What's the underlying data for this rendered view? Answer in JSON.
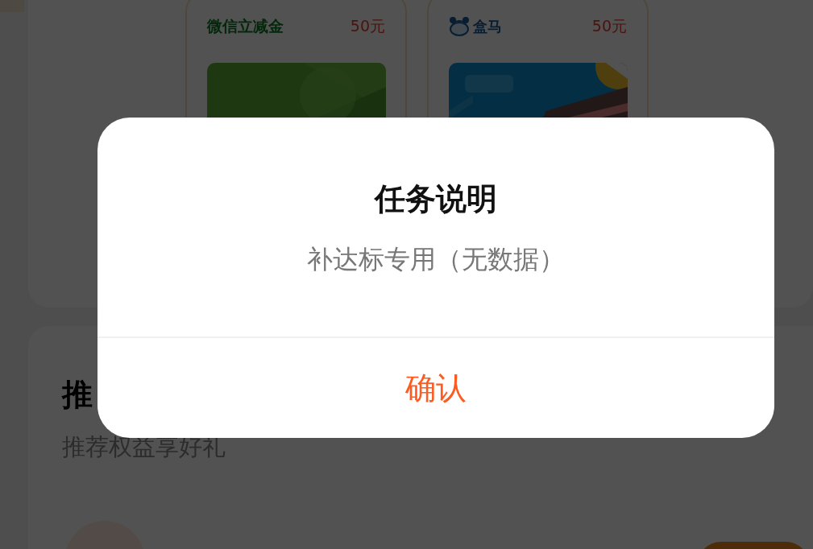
{
  "coupons": [
    {
      "brand": {
        "kind": "text",
        "name": "微信立减金"
      },
      "amount": "50元"
    },
    {
      "brand": {
        "kind": "logo",
        "name": "盒马"
      },
      "amount": "50元"
    }
  ],
  "section": {
    "title": "推",
    "subtitle": "推荐权益享好礼"
  },
  "dialog": {
    "title": "任务说明",
    "message": "补达标专用（无数据）",
    "confirm": "确认"
  }
}
